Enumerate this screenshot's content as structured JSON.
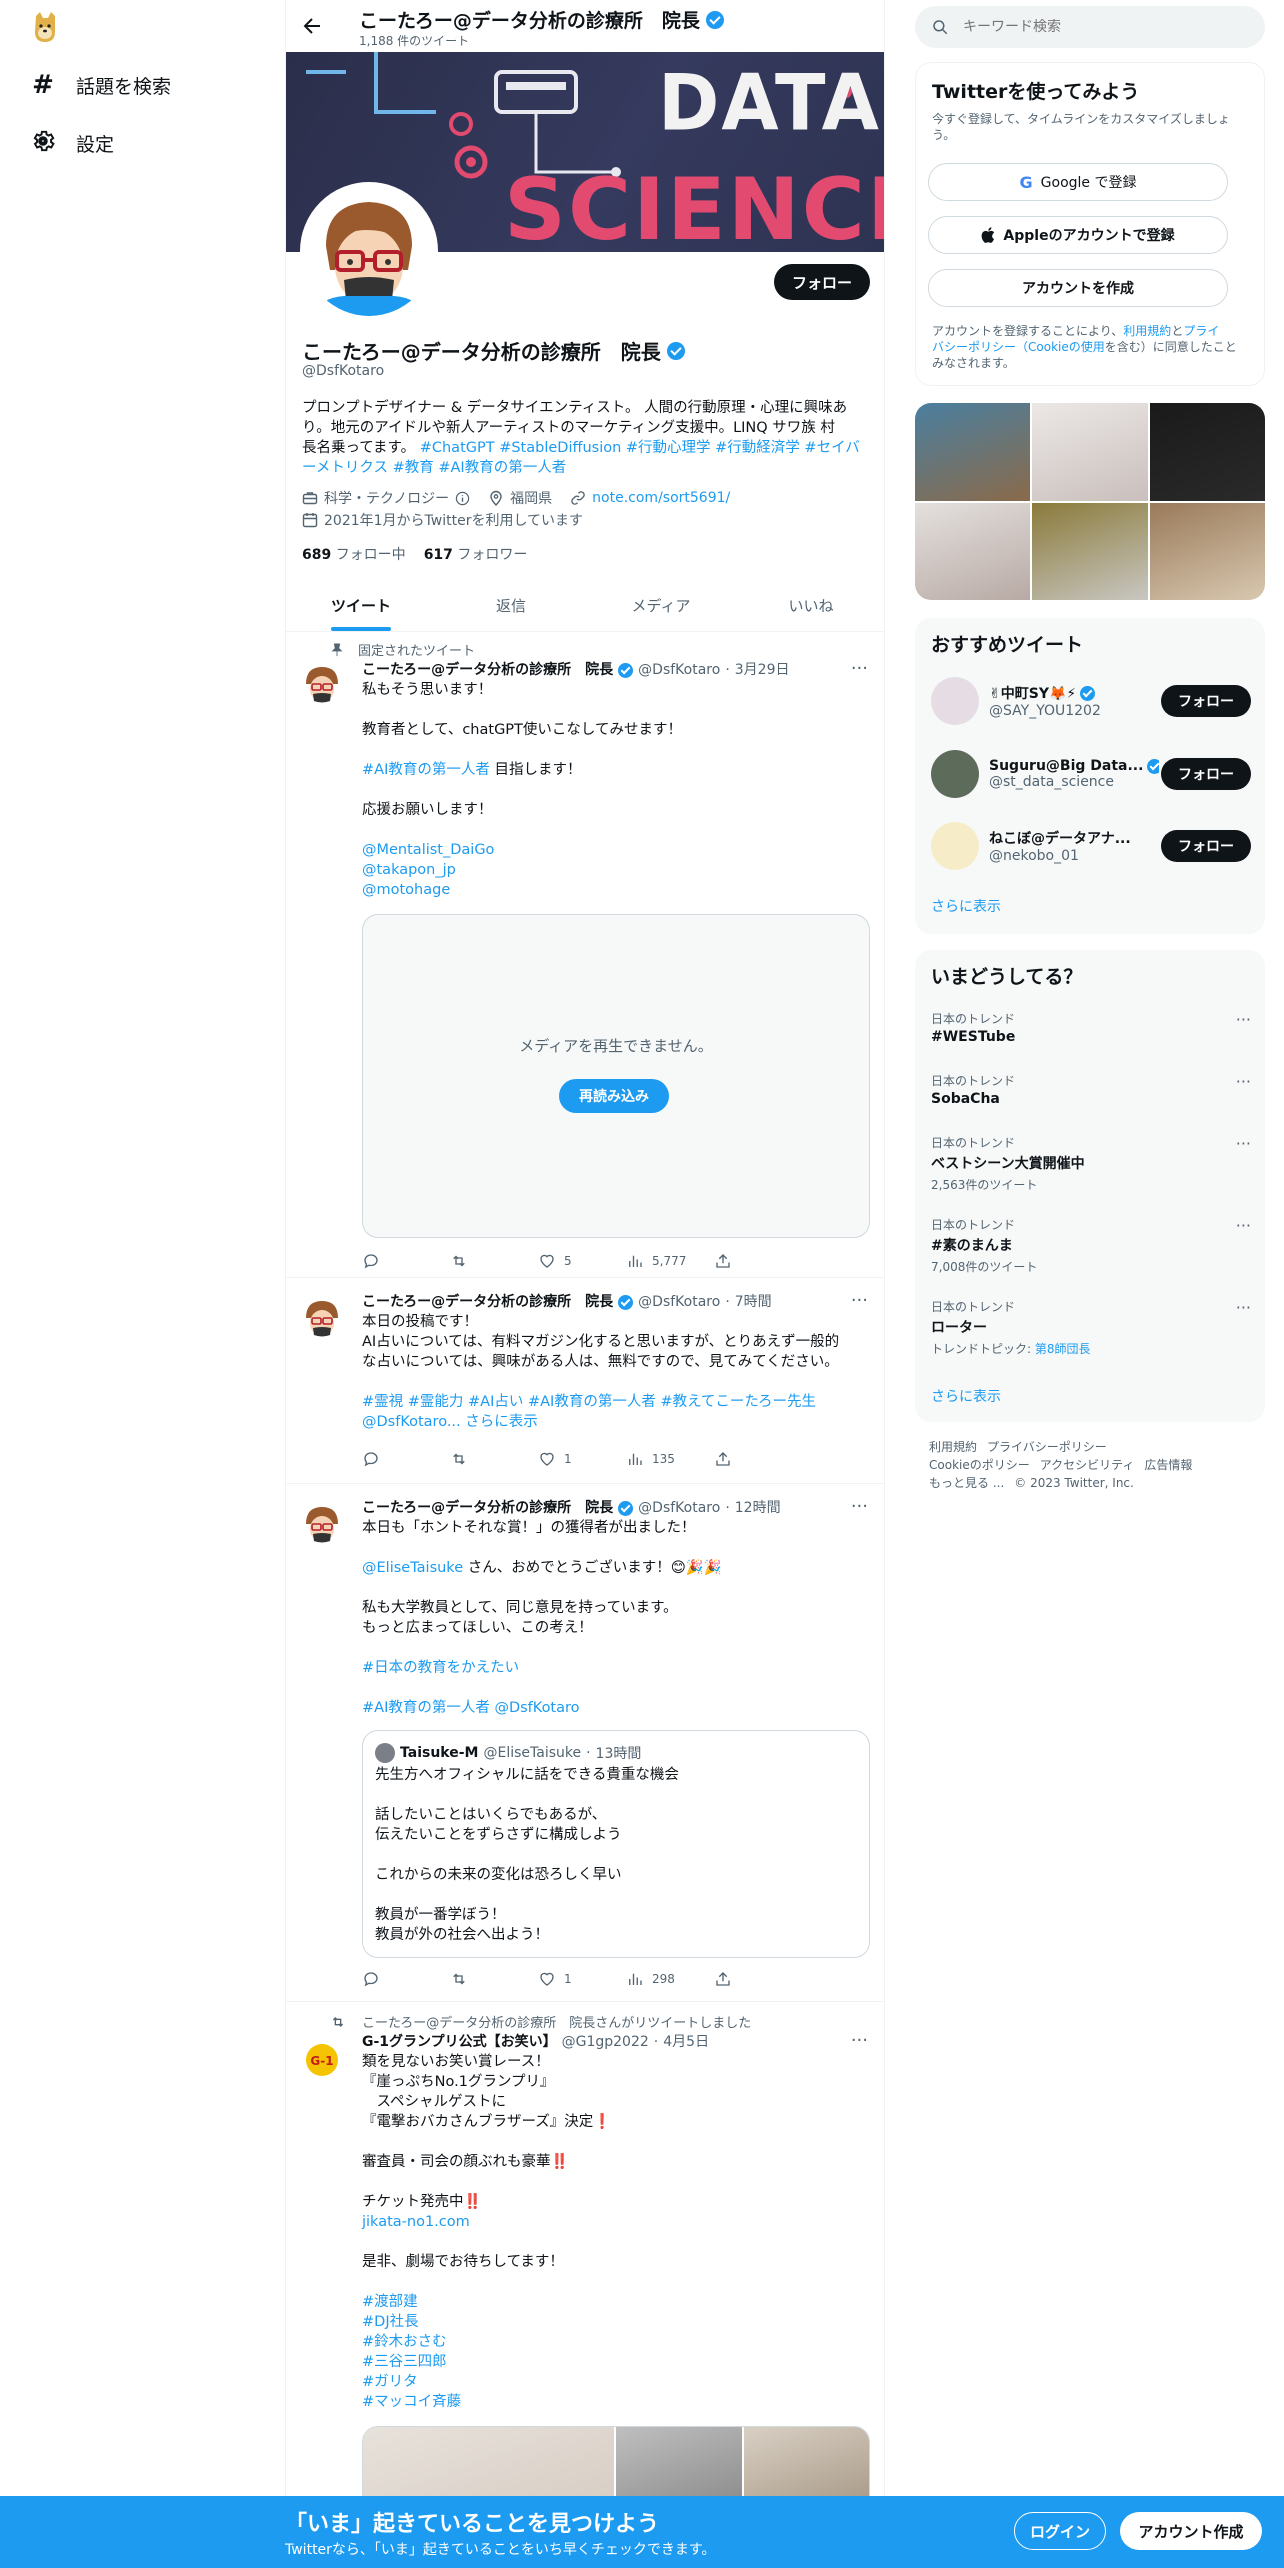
{
  "nav": {
    "search_label": "話題を検索",
    "settings_label": "設定"
  },
  "header": {
    "name": "こーたろー@データ分析の診療所　院長",
    "tweet_count": "1,188 件のツイート"
  },
  "banner": {
    "text_line1": "DATA",
    "text_line2": "SCIENCE"
  },
  "profile": {
    "name": "こーたろー@データ分析の診療所　院長",
    "handle": "@DsfKotaro",
    "follow_label": "フォロー",
    "bio_line1": "プロンプトデザイナー & データサイエンティスト。 人間の行動原理・心理に興味あ",
    "bio_line2": "り。地元のアイドルや新人アーティストのマーケティング支援中。LINQ サワ族 村",
    "bio_line3_plain": "長名乗ってます。 ",
    "bio_line3_tags": "#ChatGPT #StableDiffusion #行動心理学 #行動経済学 #セイバ",
    "bio_line4_tags": "ーメトリクス #教育 #AI教育の第一人者",
    "category": "科学・テクノロジー",
    "location": "福岡県",
    "link": "note.com/sort5691/",
    "joined": "2021年1月からTwitterを利用しています",
    "following_num": "689",
    "following_label": "フォロー中",
    "followers_num": "617",
    "followers_label": "フォロワー"
  },
  "tabs": [
    "ツイート",
    "返信",
    "メディア",
    "いいね"
  ],
  "tweets": [
    {
      "pinned_label": "固定されたツイート",
      "name": "こーたろー@データ分析の診療所　院長",
      "handle": "@DsfKotaro",
      "time": "3月29日",
      "lines": [
        "私もそう思います！",
        "",
        "教育者として、chatGPT使いこなしてみせます！",
        "",
        "",
        "",
        "応援お願いします！",
        "",
        "",
        "",
        ""
      ],
      "tag_line_tag": "#AI教育の第一人者",
      "tag_line_rest": " 目指します！",
      "mentions": [
        "@Mentalist_DaiGo",
        "@takapon_jp",
        "@motohage"
      ],
      "media_error": "メディアを再生できません。",
      "reload_label": "再読み込み",
      "replies": "",
      "retweets": "",
      "likes": "5",
      "views": "5,777"
    },
    {
      "name": "こーたろー@データ分析の診療所　院長",
      "handle": "@DsfKotaro",
      "time": "7時間",
      "line1": "本日の投稿です！",
      "line2": "AI占いについては、有料マガジン化すると思いますが、とりあえず一般的",
      "line3": "な占いについては、興味がある人は、無料ですので、見てみてください。",
      "tags": "#霊視 #霊能力 #AI占い #AI教育の第一人者 #教えてこーたろー先生",
      "tail_mention": "@DsfKotaro",
      "more_label": "... さらに表示",
      "replies": "",
      "retweets": "",
      "likes": "1",
      "views": "135"
    },
    {
      "name": "こーたろー@データ分析の診療所　院長",
      "handle": "@DsfKotaro",
      "time": "12時間",
      "line1": "本日も「ホントそれな賞！」の獲得者が出ました！",
      "mention": "@EliseTaisuke",
      "mention_rest": " さん、おめでとうございます！😊🎉🎉",
      "line3": "私も大学教員として、同じ意見を持っています。",
      "line4": "もっと広まってほしい、この考え！",
      "tag1": "#日本の教育をかえたい",
      "tag2": "#AI教育の第一人者 @DsfKotaro",
      "quote": {
        "name": "Taisuke-M",
        "handle": "@EliseTaisuke",
        "time": "13時間",
        "lines": [
          "先生方へオフィシャルに話をできる貴重な機会",
          "",
          "話したいことはいくらでもあるが、",
          "伝えたいことをずらさずに構成しよう",
          "",
          "これからの未来の変化は恐ろしく早い",
          "",
          "教員が一番学ぼう！",
          "教員が外の社会へ出よう！"
        ]
      },
      "replies": "",
      "retweets": "",
      "likes": "1",
      "views": "298"
    },
    {
      "retweet_label": "こーたろー@データ分析の診療所　院長さんがリツイートしました",
      "name": "G-1グランプリ公式【お笑い】",
      "handle": "@G1gp2022",
      "time": "4月5日",
      "lines": [
        "類を見ないお笑い賞レース！",
        "『崖っぷちNo.1グランプリ』",
        "　スペシャルゲストに",
        "『電撃おバカさんブラザーズ』決定❗",
        "",
        "審査員・司会の顔ぶれも豪華‼️",
        "",
        "チケット発売中‼️"
      ],
      "link": "jikata-no1.com",
      "line_after": "是非、劇場でお待ちしてます！",
      "tags": [
        "#渡部建",
        "#DJ社長",
        "#鈴木おさむ",
        "#三谷三四郎",
        "#ガリタ",
        "#マッコイ斉藤"
      ]
    }
  ],
  "right": {
    "search_placeholder": "キーワード検索",
    "signup": {
      "title": "Twitterを使ってみよう",
      "subtitle_line1": "今すぐ登録して、タイムラインをカスタマイズしましょ",
      "subtitle_line2": "う。",
      "google": "Google で登録",
      "apple": "Appleのアカウントで登録",
      "create": "アカウントを作成",
      "terms_1": "アカウントを登録することにより、",
      "terms_link1": "利用規約",
      "terms_2": "と",
      "terms_link2": "プライ",
      "terms_line2_link": "バシーポリシー（Cookieの使用",
      "terms_line2_rest": "を含む）に同意したこと",
      "terms_line3": "みなされます。"
    },
    "recommend": {
      "title": "おすすめツイート",
      "users": [
        {
          "name": "✌︎中町SY🦊⚡",
          "handle": "@SAY_YOU1202",
          "follow": "フォロー"
        },
        {
          "name": "Suguru@Big Data...",
          "handle": "@st_data_science",
          "follow": "フォロー"
        },
        {
          "name": "ねこぼ@データアナ...",
          "handle": "@nekobo_01",
          "follow": "フォロー"
        }
      ],
      "more": "さらに表示"
    },
    "trends": {
      "title": "いまどうしてる？",
      "items": [
        {
          "context": "日本のトレンド",
          "topic": "#WESTube",
          "count": ""
        },
        {
          "context": "日本のトレンド",
          "topic": "SobaCha",
          "count": ""
        },
        {
          "context": "日本のトレンド",
          "topic": "ベストシーン大賞開催中",
          "count": "2,563件のツイート"
        },
        {
          "context": "日本のトレンド",
          "topic": "#素のまんま",
          "count": "7,008件のツイート"
        },
        {
          "context": "日本のトレンド",
          "topic": "ローター",
          "count_prefix": "トレンドトピック: ",
          "count_link": "第8師団長"
        }
      ],
      "more": "さらに表示"
    },
    "footer": {
      "terms": "利用規約",
      "privacy": "プライバシーポリシー",
      "cookie": "Cookieのポリシー",
      "accessibility": "アクセシビリティ",
      "ads": "広告情報",
      "more": "もっと見る ...",
      "copyright": "© 2023 Twitter, Inc."
    }
  },
  "bottombar": {
    "title": "「いま」起きていることを見つけよう",
    "subtitle": "Twitterなら、「いま」起きていることをいち早くチェックできます。",
    "login": "ログイン",
    "signup": "アカウント作成"
  }
}
